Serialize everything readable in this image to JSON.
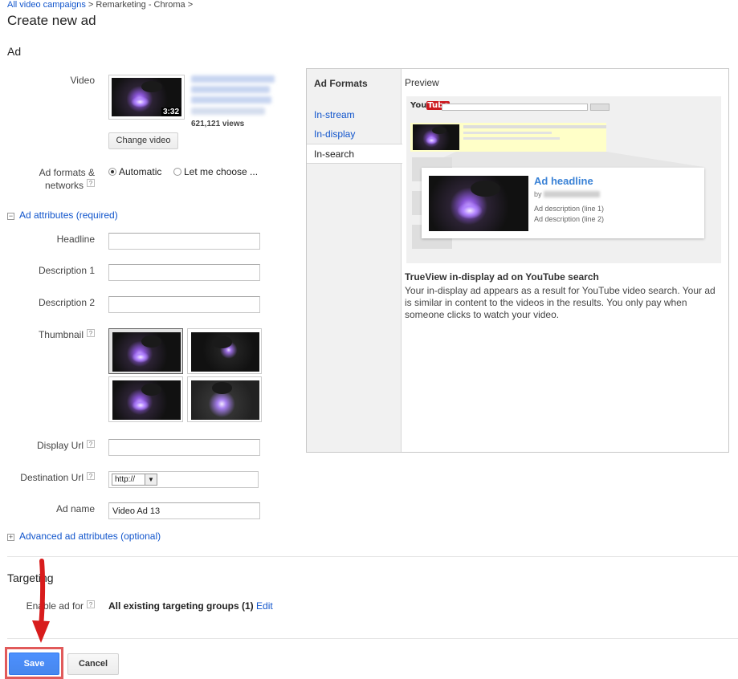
{
  "breadcrumb": {
    "campaigns_link": "All video campaigns",
    "separator": ">",
    "campaign": "Remarketing - Chroma"
  },
  "page_title": "Create new ad",
  "section_ad": "Ad",
  "video": {
    "label": "Video",
    "duration": "3:32",
    "views": "621,121 views",
    "change_button": "Change video"
  },
  "ad_formats": {
    "label_line1": "Ad formats &",
    "label_line2": "networks",
    "help": "?",
    "option_automatic": "Automatic",
    "option_choose": "Let me choose ..."
  },
  "ad_attributes": {
    "toggle": "−",
    "title": "Ad attributes (required)",
    "headline_label": "Headline",
    "headline_value": "",
    "description1_label": "Description 1",
    "description1_value": "",
    "description2_label": "Description 2",
    "description2_value": "",
    "thumbnail_label": "Thumbnail",
    "display_url_label": "Display Url",
    "display_url_value": "",
    "destination_url_label": "Destination Url",
    "protocol_selected": "http://",
    "destination_url_value": "",
    "ad_name_label": "Ad name",
    "ad_name_value": "Video Ad 13"
  },
  "advanced": {
    "toggle": "+",
    "title": "Advanced ad attributes (optional)"
  },
  "targeting": {
    "title": "Targeting",
    "enable_label": "Enable ad for",
    "value": "All existing targeting groups (1)",
    "edit_link": "Edit"
  },
  "buttons": {
    "save": "Save",
    "cancel": "Cancel"
  },
  "preview_panel": {
    "formats_title": "Ad Formats",
    "tabs": [
      "In-stream",
      "In-display",
      "In-search"
    ],
    "active_tab": "In-search",
    "preview_title": "Preview",
    "youtube_logo_you": "You",
    "youtube_logo_tube": "Tube",
    "ad_headline": "Ad headline",
    "by_prefix": "by",
    "ad_desc_line1": "Ad description (line 1)",
    "ad_desc_line2": "Ad description (line 2)",
    "info_title": "TrueView in-display ad on YouTube search",
    "info_text": "Your in-display ad appears as a result for YouTube video search. Your ad is similar in content to the videos in the results. You only pay when someone clicks to watch your video."
  },
  "colors": {
    "link": "#1155cc",
    "save_button": "#4d90fe",
    "annotation_red": "#e01b1b",
    "preview_highlight": "#ffffc8"
  }
}
